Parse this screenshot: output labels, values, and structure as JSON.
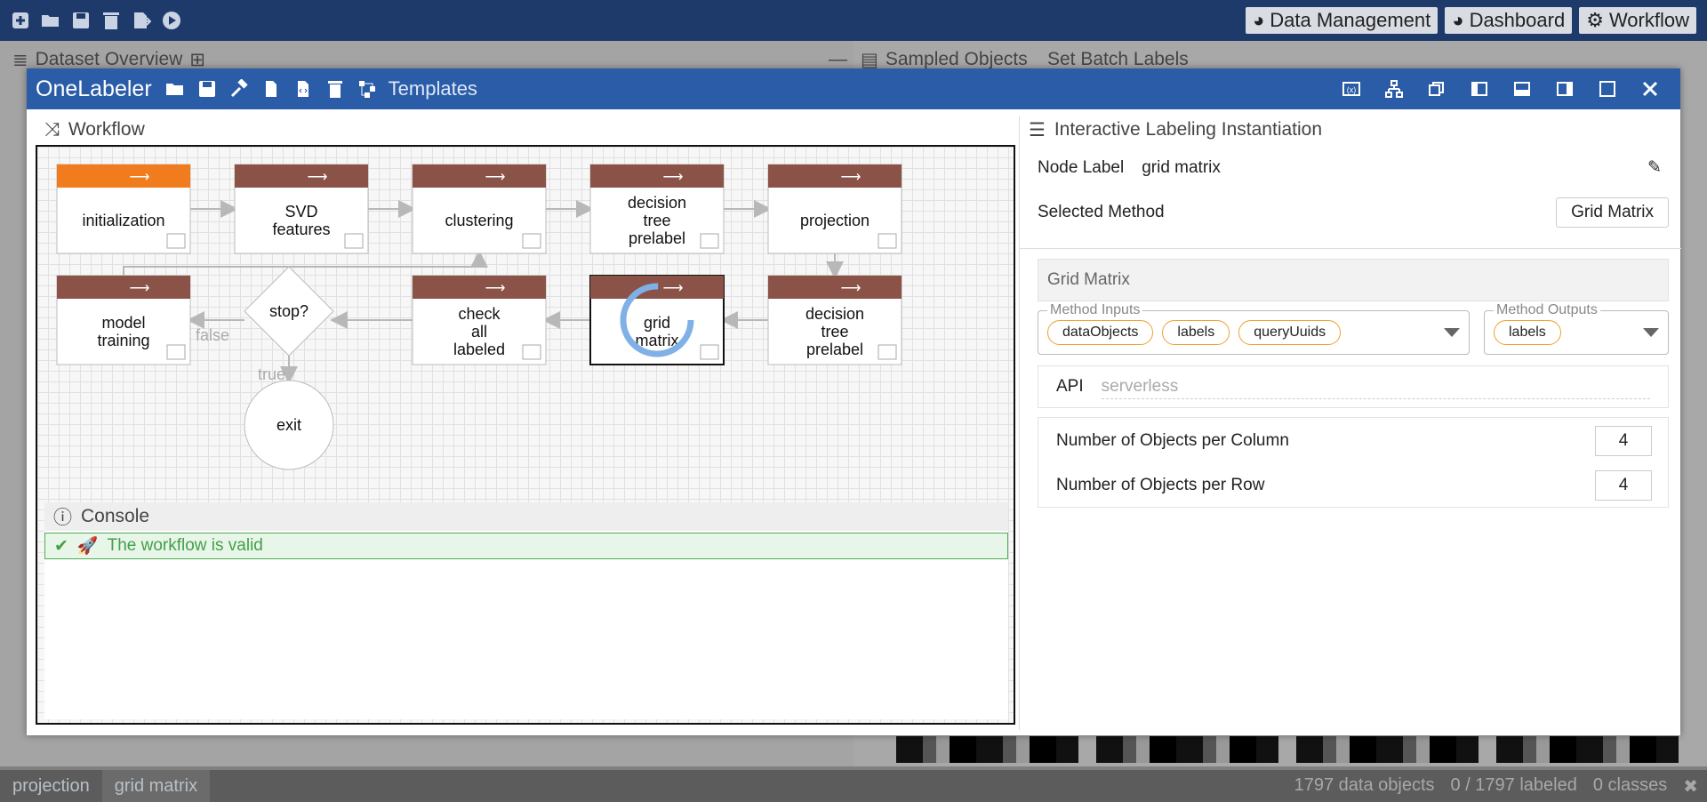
{
  "topbar": {
    "icons": [
      "plus-square-icon",
      "folder-open-icon",
      "save-icon",
      "trash-icon",
      "export-icon",
      "play-icon"
    ],
    "buttons": [
      {
        "icon": "dashboard-icon",
        "label": "Data Management"
      },
      {
        "icon": "dashboard-icon",
        "label": "Dashboard"
      },
      {
        "icon": "gears-icon",
        "label": "Workflow"
      }
    ]
  },
  "background": {
    "left_header": "Dataset Overview",
    "right_tabs": [
      "Sampled Objects",
      "Set Batch Labels"
    ]
  },
  "modal": {
    "title": "OneLabeler",
    "templates_label": "Templates"
  },
  "workflow": {
    "title": "Workflow",
    "nodes": [
      {
        "id": "n1",
        "label": "initialization",
        "header_color": "#f07c1e"
      },
      {
        "id": "n2",
        "label": "SVD features",
        "header_color": "#8b5348"
      },
      {
        "id": "n3",
        "label": "clustering",
        "header_color": "#8b5348"
      },
      {
        "id": "n4",
        "label": "decision tree prelabel",
        "header_color": "#8b5348"
      },
      {
        "id": "n5",
        "label": "projection",
        "header_color": "#8b5348"
      },
      {
        "id": "n6",
        "label": "model training",
        "header_color": "#8b5348"
      },
      {
        "id": "n7",
        "label": "stop?"
      },
      {
        "id": "n8",
        "label": "check all labeled",
        "header_color": "#8b5348"
      },
      {
        "id": "n9",
        "label": "grid matrix",
        "header_color": "#8b5348"
      },
      {
        "id": "n10",
        "label": "decision tree prelabel",
        "header_color": "#8b5348"
      },
      {
        "id": "n11",
        "label": "exit"
      }
    ],
    "edge_labels": {
      "false": "false",
      "true": "true"
    }
  },
  "console": {
    "title": "Console",
    "message": "The workflow is valid"
  },
  "panel": {
    "title": "Interactive Labeling Instantiation",
    "node_label_key": "Node Label",
    "node_label_value": "grid matrix",
    "selected_method_key": "Selected Method",
    "selected_method_value": "Grid Matrix",
    "method_name": "Grid Matrix",
    "method_inputs_legend": "Method Inputs",
    "method_inputs": [
      "dataObjects",
      "labels",
      "queryUuids"
    ],
    "method_outputs_legend": "Method Outputs",
    "method_outputs": [
      "labels"
    ],
    "api_key": "API",
    "api_placeholder": "serverless",
    "params": [
      {
        "label": "Number of Objects per Column",
        "value": "4"
      },
      {
        "label": "Number of Objects per Row",
        "value": "4"
      }
    ]
  },
  "statusbar": {
    "tabs": [
      "projection",
      "grid matrix"
    ],
    "data_objects": "1797 data objects",
    "labeled": "0 / 1797 labeled",
    "classes": "0 classes"
  }
}
